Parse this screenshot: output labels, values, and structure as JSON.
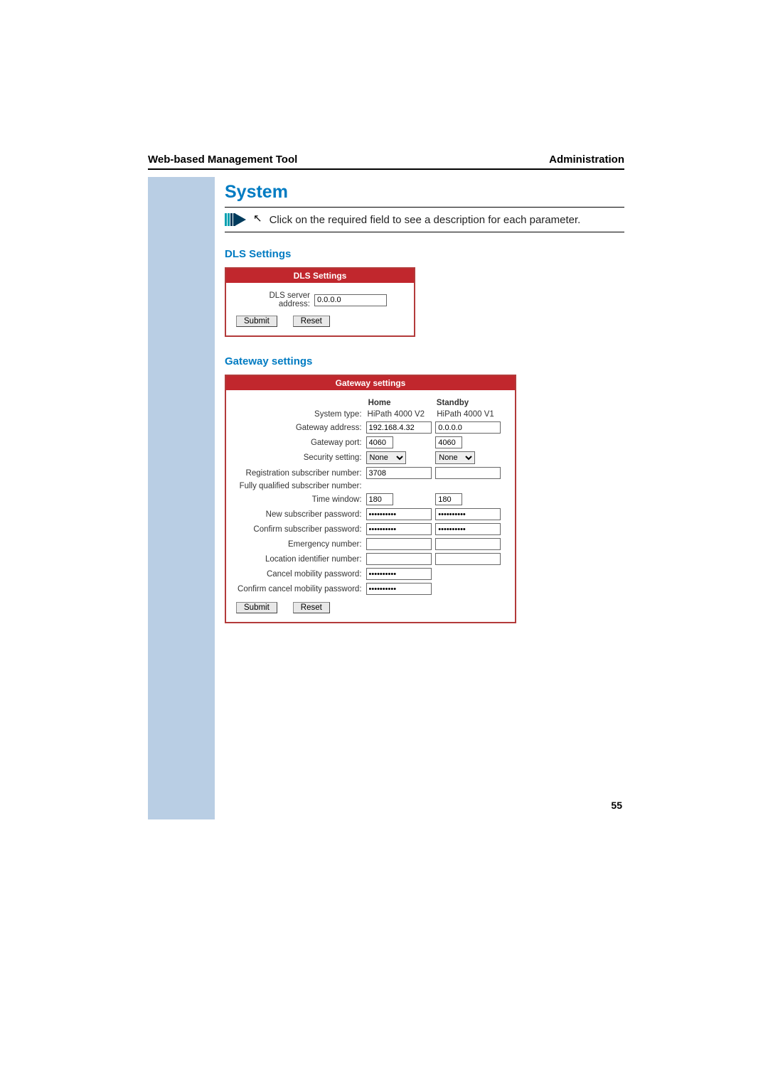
{
  "header": {
    "left": "Web-based Management Tool",
    "right": "Administration"
  },
  "title": "System",
  "note": "Click on the required field to see a description for each parameter.",
  "page_number": "55",
  "dls": {
    "heading": "DLS Settings",
    "panel_title": "DLS Settings",
    "label": "DLS server address:",
    "value": "0.0.0.0",
    "submit": "Submit",
    "reset": "Reset"
  },
  "gateway": {
    "heading": "Gateway settings",
    "panel_title": "Gateway settings",
    "col_home": "Home",
    "col_standby": "Standby",
    "rows": {
      "system_type": {
        "label": "System type:",
        "home": "HiPath 4000 V2",
        "standby": "HiPath 4000 V1"
      },
      "gateway_address": {
        "label": "Gateway address:",
        "home": "192.168.4.32",
        "standby": "0.0.0.0"
      },
      "gateway_port": {
        "label": "Gateway port:",
        "home": "4060",
        "standby": "4060"
      },
      "security": {
        "label": "Security setting:",
        "home": "None",
        "standby": "None"
      },
      "reg_num": {
        "label": "Registration subscriber number:",
        "home": "3708"
      },
      "fq_num": {
        "label": "Fully qualified subscriber number:"
      },
      "time_window": {
        "label": "Time window:",
        "home": "180",
        "standby": "180"
      },
      "new_pw": {
        "label": "New subscriber password:",
        "home": "**********",
        "standby": "**********"
      },
      "conf_pw": {
        "label": "Confirm subscriber password:",
        "home": "**********",
        "standby": "**********"
      },
      "emergency": {
        "label": "Emergency number:",
        "home": "",
        "standby": ""
      },
      "loc_id": {
        "label": "Location identifier number:",
        "home": "",
        "standby": ""
      },
      "cancel_mob_pw": {
        "label": "Cancel mobility password:",
        "home": "**********"
      },
      "conf_cancel_mob_pw": {
        "label": "Confirm cancel mobility password:",
        "home": "**********"
      }
    },
    "submit": "Submit",
    "reset": "Reset"
  }
}
